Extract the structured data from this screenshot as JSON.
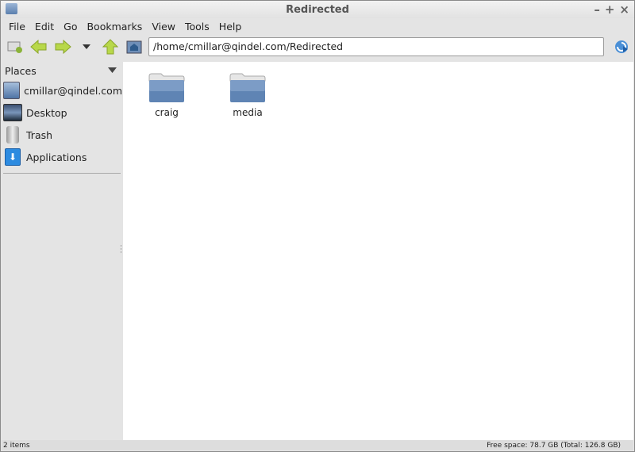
{
  "window": {
    "title": "Redirected",
    "controls": [
      "–",
      "+",
      "×"
    ]
  },
  "menu": [
    "File",
    "Edit",
    "Go",
    "Bookmarks",
    "View",
    "Tools",
    "Help"
  ],
  "toolbar": {
    "icons": [
      "new-window-icon",
      "back-icon",
      "forward-icon",
      "history-dropdown-icon",
      "up-icon",
      "home-icon"
    ],
    "path": "/home/cmillar@qindel.com/Redirected",
    "go_icon": "go-icon"
  },
  "sidebar": {
    "header": "Places",
    "items": [
      {
        "label": "cmillar@qindel.com",
        "icon": "home-folder-icon"
      },
      {
        "label": "Desktop",
        "icon": "desktop-icon"
      },
      {
        "label": "Trash",
        "icon": "trash-icon"
      },
      {
        "label": "Applications",
        "icon": "applications-icon"
      }
    ]
  },
  "files": [
    {
      "name": "craig"
    },
    {
      "name": "media"
    }
  ],
  "status": {
    "left": "2 items",
    "right": "Free space: 78.7 GB (Total: 126.8 GB)"
  }
}
